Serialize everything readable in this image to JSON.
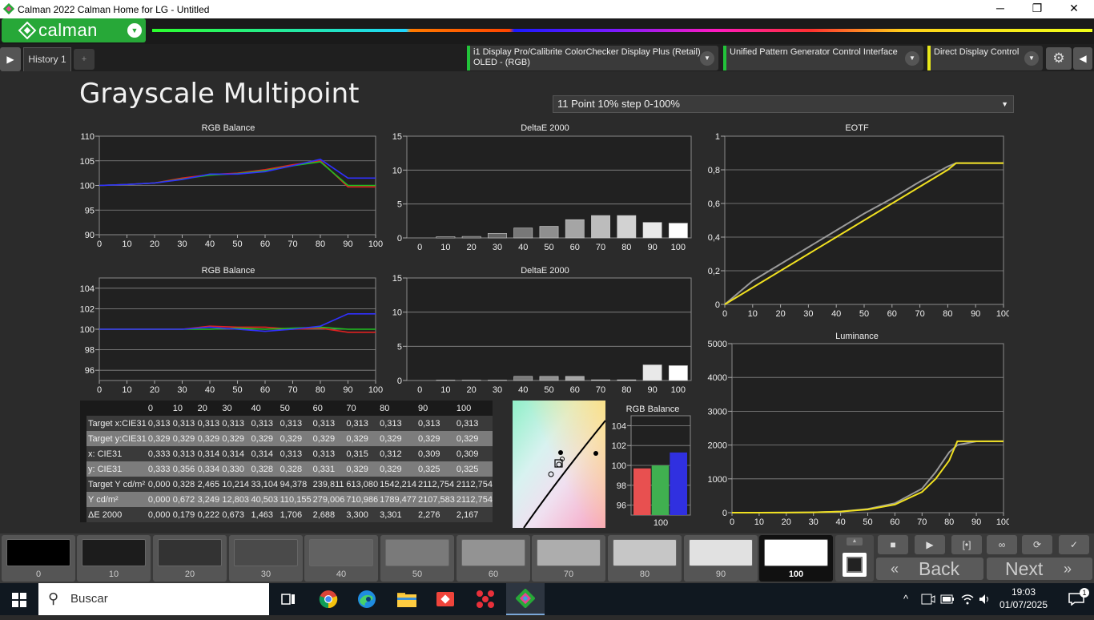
{
  "window": {
    "title": "Calman 2022 Calman Home for LG  - Untitled",
    "minimize": "─",
    "restore": "❐",
    "close": "✕"
  },
  "app": {
    "logo_text": "calman",
    "tab_label": "History 1",
    "add_tab": "+",
    "devices": [
      {
        "line1": "i1 Display Pro/Calibrite ColorChecker Display Plus (Retail)",
        "line2": "OLED - (RGB)",
        "color": "#22c33a"
      },
      {
        "line1": "Unified Pattern Generator Control Interface",
        "line2": "",
        "color": "#22c33a"
      },
      {
        "line1": "Direct Display Control",
        "line2": "",
        "color": "#e8e81a"
      }
    ]
  },
  "page": {
    "title": "Grayscale Multipoint",
    "mode_select": "11 Point 10% step 0-100%"
  },
  "chart_data": [
    {
      "id": "rgb_balance_top",
      "type": "line",
      "title": "RGB Balance",
      "x": [
        0,
        10,
        20,
        30,
        40,
        50,
        60,
        70,
        80,
        90,
        100
      ],
      "ylim": [
        90,
        110
      ],
      "yticks": [
        90,
        95,
        100,
        105,
        110
      ],
      "series": [
        {
          "color": "#e02020",
          "values": [
            100,
            100.2,
            100.5,
            101.5,
            102.2,
            102.5,
            103.2,
            104.2,
            105.0,
            99.7,
            99.7
          ]
        },
        {
          "color": "#20c020",
          "values": [
            100,
            100.2,
            100.5,
            101.3,
            102.1,
            102.4,
            103.0,
            104.0,
            104.8,
            100.0,
            100.0
          ]
        },
        {
          "color": "#3030ff",
          "values": [
            100,
            100.2,
            100.5,
            101.2,
            102.3,
            102.3,
            102.8,
            104.0,
            105.3,
            101.5,
            101.5
          ]
        }
      ]
    },
    {
      "id": "deltae_top",
      "type": "bar",
      "title": "DeltaE 2000",
      "categories": [
        "0",
        "10",
        "20",
        "30",
        "40",
        "50",
        "60",
        "70",
        "80",
        "90",
        "100"
      ],
      "values": [
        0,
        0.18,
        0.22,
        0.67,
        1.46,
        1.71,
        2.69,
        3.3,
        3.3,
        2.28,
        2.17
      ],
      "ylim": [
        0,
        15
      ],
      "yticks": [
        0,
        5,
        10,
        15
      ]
    },
    {
      "id": "eotf",
      "type": "line",
      "title": "EOTF",
      "x": [
        0,
        10,
        20,
        30,
        40,
        50,
        60,
        70,
        80,
        83,
        90,
        100
      ],
      "ylim": [
        0,
        1
      ],
      "yticks": [
        "0",
        "0,2",
        "0,4",
        "0,6",
        "0,8",
        "1"
      ],
      "xticks": [
        0,
        10,
        20,
        30,
        40,
        50,
        60,
        70,
        80,
        90,
        100
      ],
      "series": [
        {
          "color": "#9a9a9a",
          "values": [
            0,
            0.14,
            0.24,
            0.34,
            0.44,
            0.54,
            0.63,
            0.73,
            0.82,
            0.84,
            0.84,
            0.84
          ]
        },
        {
          "color": "#f0e020",
          "values": [
            0,
            0.1,
            0.2,
            0.3,
            0.4,
            0.5,
            0.6,
            0.7,
            0.8,
            0.84,
            0.84,
            0.84
          ]
        }
      ]
    },
    {
      "id": "rgb_balance_bottom",
      "type": "line",
      "title": "RGB Balance",
      "x": [
        0,
        10,
        20,
        30,
        40,
        50,
        60,
        70,
        80,
        90,
        100
      ],
      "ylim": [
        95,
        105
      ],
      "yticks": [
        96,
        98,
        100,
        102,
        104
      ],
      "series": [
        {
          "color": "#e02020",
          "values": [
            100,
            100,
            100,
            100,
            100.3,
            100.2,
            100.2,
            100.0,
            100.1,
            99.7,
            99.7
          ]
        },
        {
          "color": "#20c020",
          "values": [
            100,
            100,
            100,
            100,
            100.0,
            100.1,
            100.0,
            100.1,
            100.2,
            100.0,
            100.0
          ]
        },
        {
          "color": "#3030ff",
          "values": [
            100,
            100,
            100,
            100,
            100.2,
            100.0,
            99.8,
            100.0,
            100.3,
            101.5,
            101.5
          ]
        }
      ]
    },
    {
      "id": "deltae_bottom",
      "type": "bar",
      "title": "DeltaE 2000",
      "categories": [
        "0",
        "10",
        "20",
        "30",
        "40",
        "50",
        "60",
        "70",
        "80",
        "90",
        "100"
      ],
      "values": [
        0,
        0.05,
        0.05,
        0.05,
        0.6,
        0.6,
        0.6,
        0.1,
        0.1,
        2.28,
        2.17
      ],
      "ylim": [
        0,
        15
      ],
      "yticks": [
        0,
        5,
        10,
        15
      ]
    },
    {
      "id": "luminance",
      "type": "line",
      "title": "Luminance",
      "x": [
        0,
        10,
        20,
        30,
        40,
        50,
        60,
        70,
        75,
        80,
        83,
        90,
        100
      ],
      "ylim": [
        0,
        5000
      ],
      "yticks": [
        0,
        1000,
        2000,
        3000,
        4000,
        5000
      ],
      "xticks": [
        0,
        10,
        20,
        30,
        40,
        50,
        60,
        70,
        80,
        90,
        100
      ],
      "series": [
        {
          "color": "#9a9a9a",
          "values": [
            0,
            1,
            3,
            10,
            33,
            110,
            279,
            711,
            1200,
            1789,
            2000,
            2108,
            2113
          ]
        },
        {
          "color": "#f0e020",
          "values": [
            0,
            0.3,
            2,
            10,
            33,
            94,
            240,
            613,
            1000,
            1542,
            2113,
            2113,
            2113
          ]
        }
      ]
    },
    {
      "id": "rgb_balance_bar",
      "type": "bar",
      "title": "RGB Balance",
      "categories": [
        "100"
      ],
      "series": [
        {
          "color": "#e85050",
          "values": [
            99.7
          ]
        },
        {
          "color": "#40b050",
          "values": [
            100.0
          ]
        },
        {
          "color": "#3030e0",
          "values": [
            101.3
          ]
        }
      ],
      "ylim": [
        95,
        105
      ],
      "yticks": [
        96,
        98,
        100,
        102,
        104
      ]
    }
  ],
  "table": {
    "columns": [
      "",
      "0",
      "10",
      "20",
      "30",
      "40",
      "50",
      "60",
      "70",
      "80",
      "90",
      "100"
    ],
    "rows": [
      {
        "label": "Target x:CIE31",
        "values": [
          "0,313",
          "0,313",
          "0,313",
          "0,313",
          "0,313",
          "0,313",
          "0,313",
          "0,313",
          "0,313",
          "0,313",
          "0,313"
        ]
      },
      {
        "label": "Target y:CIE31",
        "values": [
          "0,329",
          "0,329",
          "0,329",
          "0,329",
          "0,329",
          "0,329",
          "0,329",
          "0,329",
          "0,329",
          "0,329",
          "0,329"
        ]
      },
      {
        "label": "x: CIE31",
        "values": [
          "0,333",
          "0,313",
          "0,314",
          "0,314",
          "0,314",
          "0,313",
          "0,313",
          "0,315",
          "0,312",
          "0,309",
          "0,309"
        ]
      },
      {
        "label": "y: CIE31",
        "values": [
          "0,333",
          "0,356",
          "0,334",
          "0,330",
          "0,328",
          "0,328",
          "0,331",
          "0,329",
          "0,329",
          "0,325",
          "0,325"
        ]
      },
      {
        "label": "Target Y cd/m²",
        "values": [
          "0,000",
          "0,328",
          "2,465",
          "10,214",
          "33,104",
          "94,378",
          "239,811",
          "613,080",
          "1542,214",
          "2112,754",
          "2112,754"
        ]
      },
      {
        "label": "Y cd/m²",
        "values": [
          "0,000",
          "0,672",
          "3,249",
          "12,803",
          "40,503",
          "110,155",
          "279,006",
          "710,986",
          "1789,477",
          "2107,583",
          "2112,754"
        ]
      },
      {
        "label": "ΔE 2000",
        "values": [
          "0,000",
          "0,179",
          "0,222",
          "0,673",
          "1,463",
          "1,706",
          "2,688",
          "3,300",
          "3,301",
          "2,276",
          "2,167"
        ]
      }
    ]
  },
  "swatches": [
    {
      "label": "0",
      "color": "#000000"
    },
    {
      "label": "10",
      "color": "#1c1c1c"
    },
    {
      "label": "20",
      "color": "#333333"
    },
    {
      "label": "30",
      "color": "#4a4a4a"
    },
    {
      "label": "40",
      "color": "#626262"
    },
    {
      "label": "50",
      "color": "#7a7a7a"
    },
    {
      "label": "60",
      "color": "#939393"
    },
    {
      "label": "70",
      "color": "#adadad"
    },
    {
      "label": "80",
      "color": "#c6c6c6"
    },
    {
      "label": "90",
      "color": "#e1e1e1"
    },
    {
      "label": "100",
      "color": "#ffffff"
    }
  ],
  "nav": {
    "back": "Back",
    "next": "Next"
  },
  "taskbar": {
    "search_placeholder": "Buscar",
    "time": "19:03",
    "date": "01/07/2025",
    "notifications": "1"
  }
}
